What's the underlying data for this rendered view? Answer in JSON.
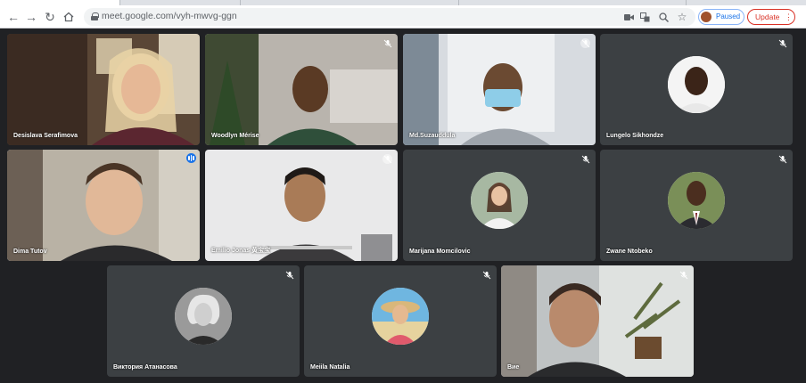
{
  "browser": {
    "url": "meet.google.com/vyh-mwvg-ggn",
    "profile_label": "Paused",
    "update_label": "Update",
    "icons": [
      "back-arrow-icon",
      "forward-arrow-icon",
      "reload-icon",
      "home-icon",
      "lock-icon",
      "camera-icon",
      "translate-icon",
      "zoom-icon",
      "star-icon",
      "kebab-menu-icon"
    ]
  },
  "participants": [
    {
      "name": "Desislava Serafimova",
      "mic": "none",
      "mode": "video"
    },
    {
      "name": "Woodlyn Mérise",
      "mic": "muted",
      "mode": "video"
    },
    {
      "name": "Md.Suzauddula",
      "mic": "muted-circle",
      "mode": "video"
    },
    {
      "name": "Lungelo Sikhondze",
      "mic": "muted",
      "mode": "avatar"
    },
    {
      "name": "Dima Tutov",
      "mic": "speaking",
      "mode": "video"
    },
    {
      "name": "Emilio Jonas 黄宝宝",
      "mic": "muted-circle",
      "mode": "video"
    },
    {
      "name": "Marijana Momcilovic",
      "mic": "muted",
      "mode": "avatar"
    },
    {
      "name": "Zwane Ntobeko",
      "mic": "muted",
      "mode": "avatar"
    },
    {
      "name": "Виктория Атанасова",
      "mic": "muted",
      "mode": "avatar"
    },
    {
      "name": "Meiila Natalia",
      "mic": "muted",
      "mode": "avatar"
    },
    {
      "name": "Вие",
      "mic": "muted",
      "mode": "video"
    }
  ],
  "colors": {
    "background": "#202124",
    "tile": "#3c4043",
    "active_outline": "#8ab4f8",
    "speaking": "#1a73e8",
    "update": "#d93025"
  }
}
